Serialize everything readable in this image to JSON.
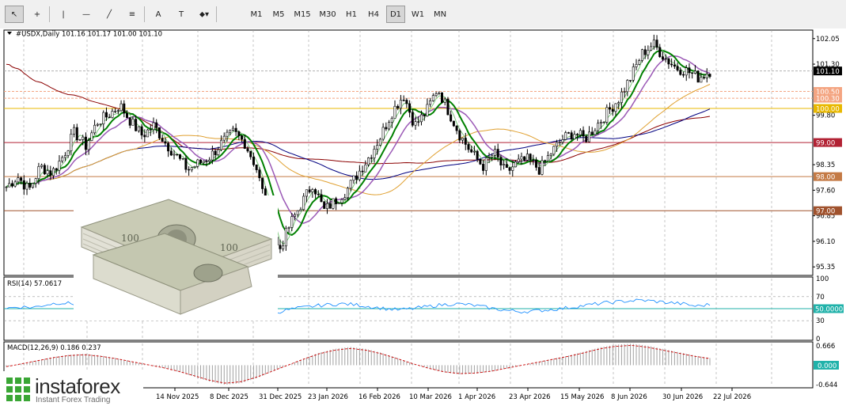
{
  "toolbar": {
    "tools": [
      {
        "id": "cursor",
        "glyph": "↖"
      },
      {
        "id": "crosshair",
        "glyph": "+"
      },
      {
        "id": "vertical-line",
        "glyph": "|"
      },
      {
        "id": "horizontal-line",
        "glyph": "—"
      },
      {
        "id": "trend-line",
        "glyph": "╱"
      },
      {
        "id": "fibonacci",
        "glyph": "≡"
      },
      {
        "id": "text",
        "glyph": "A"
      },
      {
        "id": "text-label",
        "glyph": "T"
      },
      {
        "id": "shapes",
        "glyph": "⬥▾"
      }
    ],
    "timeframes": [
      "M1",
      "M5",
      "M15",
      "M30",
      "H1",
      "H4",
      "D1",
      "W1",
      "MN"
    ],
    "selected_timeframe": "D1"
  },
  "chart_header": "#USDX,Daily  101.16 101.17 101.00 101.10",
  "rsi_header": "RSI(14) 57.0617",
  "macd_header": "MACD(12,26,9) 0.186 0.237",
  "price_axis_labels": [
    "102.05",
    "101.30",
    "99.80",
    "98.35",
    "97.60",
    "96.85",
    "96.10",
    "95.35"
  ],
  "price_tags": [
    {
      "label": "101.10",
      "value": 101.1,
      "bg": "#000000",
      "fg": "#ffffff"
    },
    {
      "label": "100.50",
      "value": 100.5,
      "bg": "#f4a582",
      "fg": "#ffffff"
    },
    {
      "label": "100.30",
      "value": 100.3,
      "bg": "#f4a582",
      "fg": "#ffffff"
    },
    {
      "label": "100.00",
      "value": 100.0,
      "bg": "#e8b800",
      "fg": "#ffffff"
    },
    {
      "label": "99.00",
      "value": 99.0,
      "bg": "#b22234",
      "fg": "#ffffff"
    },
    {
      "label": "98.00",
      "value": 98.0,
      "bg": "#c47a45",
      "fg": "#ffffff"
    },
    {
      "label": "97.00",
      "value": 97.0,
      "bg": "#a0522d",
      "fg": "#ffffff"
    }
  ],
  "rsi_axis_labels": [
    "100",
    "70",
    "30",
    "0"
  ],
  "rsi_tag": "50.0000",
  "macd_axis_labels": [
    "0.666",
    "-0.644"
  ],
  "macd_tag": "0.000",
  "date_labels": [
    "14 Nov 2025",
    "8 Dec 2025",
    "31 Dec 2025",
    "23 Jan 2026",
    "16 Feb 2026",
    "10 Mar 2026",
    "1 Apr 2026",
    "23 Apr 2026",
    "15 May 2026",
    "8 Jun 2026",
    "30 Jun 2026",
    "22 Jul 2026"
  ],
  "logo": {
    "name": "instaforex",
    "tagline": "Instant Forex Trading"
  },
  "colors": {
    "ma_fast": "#008000",
    "ma_slow": "#9b59b6",
    "ma_orange": "#e0a030",
    "ma_navy": "#000080",
    "ma_red": "#8b0000",
    "rsi": "#1e90ff",
    "rsi_level": "#20b2aa",
    "macd_signal": "#cc0000",
    "macd_hist": "#a0a0a0"
  },
  "chart_data": {
    "type": "candlestick",
    "symbol": "#USDX",
    "timeframe": "Daily",
    "ohlc_current": {
      "open": 101.16,
      "high": 101.17,
      "low": 101.0,
      "close": 101.1
    },
    "ylim": [
      95.1,
      102.3
    ],
    "x": [
      "14 Nov 2025",
      "8 Dec 2025",
      "31 Dec 2025",
      "23 Jan 2026",
      "16 Feb 2026",
      "10 Mar 2026",
      "1 Apr 2026",
      "23 Apr 2026",
      "15 May 2026",
      "8 Jun 2026",
      "30 Jun 2026",
      "22 Jul 2026"
    ],
    "close_path": [
      97.7,
      98.0,
      97.6,
      98.3,
      98.1,
      98.6,
      99.3,
      98.9,
      99.6,
      99.8,
      100.1,
      99.6,
      99.2,
      99.5,
      99.0,
      98.6,
      98.2,
      98.4,
      98.6,
      99.0,
      99.3,
      99.0,
      98.3,
      97.0,
      95.8,
      96.6,
      97.2,
      97.8,
      97.0,
      97.3,
      97.6,
      98.1,
      98.6,
      99.2,
      99.9,
      100.4,
      99.5,
      99.9,
      100.6,
      99.9,
      99.2,
      98.7,
      98.3,
      98.7,
      98.1,
      98.4,
      98.5,
      98.2,
      98.7,
      99.1,
      99.3,
      99.1,
      99.5,
      99.9,
      100.3,
      100.9,
      101.6,
      101.9,
      101.5,
      101.2,
      101.1,
      100.9,
      101.1
    ]
  },
  "rsi_data": {
    "levels": [
      70,
      50,
      30
    ],
    "values": [
      51,
      53,
      52,
      57,
      60,
      58,
      56,
      52,
      48,
      46,
      44,
      43,
      45,
      47,
      50,
      46,
      42,
      38,
      33,
      39,
      44,
      49,
      52,
      55,
      57,
      58,
      56,
      53,
      50,
      48,
      50,
      53,
      56,
      58,
      57,
      54,
      50,
      47,
      45,
      46,
      48,
      50,
      53,
      56,
      59,
      61,
      63,
      64,
      62,
      60,
      58,
      54,
      57
    ]
  },
  "macd_data": {
    "hist": [
      -0.05,
      0.05,
      0.15,
      0.25,
      0.32,
      0.35,
      0.3,
      0.22,
      0.12,
      0.02,
      -0.08,
      -0.2,
      -0.35,
      -0.5,
      -0.6,
      -0.55,
      -0.4,
      -0.2,
      0.0,
      0.2,
      0.38,
      0.5,
      0.56,
      0.5,
      0.38,
      0.22,
      0.05,
      -0.1,
      -0.22,
      -0.28,
      -0.26,
      -0.2,
      -0.1,
      0.0,
      0.1,
      0.2,
      0.3,
      0.42,
      0.55,
      0.63,
      0.66,
      0.6,
      0.5,
      0.4,
      0.3,
      0.22
    ]
  }
}
